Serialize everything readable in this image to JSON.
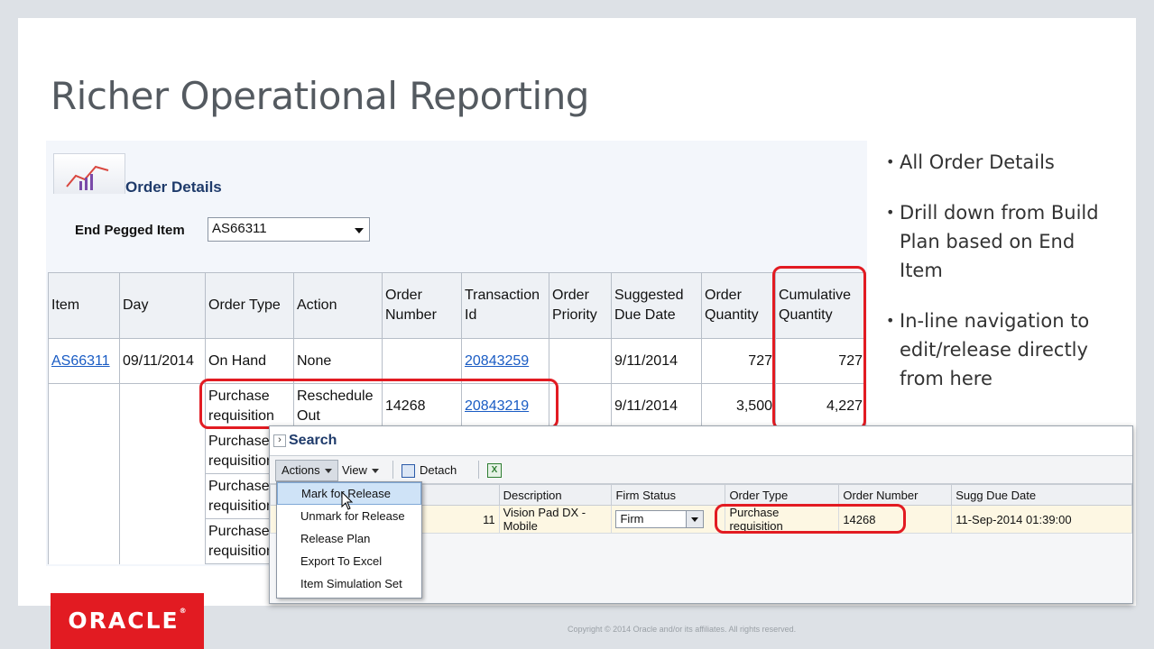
{
  "slide": {
    "title": "Richer Operational Reporting",
    "copyright": "Copyright © 2014 Oracle and/or its affiliates. All rights reserved.",
    "logo_text": "ORACLE"
  },
  "report": {
    "title": "Order Details",
    "end_pegged_label": "End Pegged Item",
    "end_pegged_value": "AS66311",
    "columns": [
      "Item",
      "Day",
      "Order Type",
      "Action",
      "Order Number",
      "Transaction Id",
      "Order Priority",
      "Suggested Due Date",
      "Order Quantity",
      "Cumulative Quantity"
    ],
    "rows": [
      {
        "item": "AS66311",
        "day": "09/11/2014",
        "order_type": "On Hand",
        "action": "None",
        "order_number": "",
        "transaction_id": "20843259",
        "priority": "",
        "due_date": "9/11/2014",
        "quantity": "727",
        "cumulative": "727"
      },
      {
        "item": "",
        "day": "",
        "order_type": "Purchase requisition",
        "action": "Reschedule Out",
        "order_number": "14268",
        "transaction_id": "20843219",
        "priority": "",
        "due_date": "9/11/2014",
        "quantity": "3,500",
        "cumulative": "4,227"
      },
      {
        "order_type": "Purchase requisition"
      },
      {
        "order_type": "Purchase requisition"
      },
      {
        "order_type": "Purchase requisition"
      }
    ]
  },
  "bullets": [
    "All Order Details",
    "Drill down from Build Plan based on End Item",
    "In-line navigation to edit/release directly from here"
  ],
  "search": {
    "title": "Search",
    "toolbar": {
      "actions": "Actions",
      "view": "View",
      "detach": "Detach"
    },
    "columns": [
      "Description",
      "Firm Status",
      "Order Type",
      "Order Number",
      "Sugg Due Date"
    ],
    "row": {
      "item_fragment": "11",
      "description": "Vision Pad DX - Mobile",
      "firm_status": "Firm",
      "order_type": "Purchase requisition",
      "order_number": "14268",
      "due_date": "11-Sep-2014 01:39:00"
    },
    "menu": [
      "Mark for Release",
      "Unmark for Release",
      "Release Plan",
      "Export To Excel",
      "Item Simulation Set"
    ]
  }
}
